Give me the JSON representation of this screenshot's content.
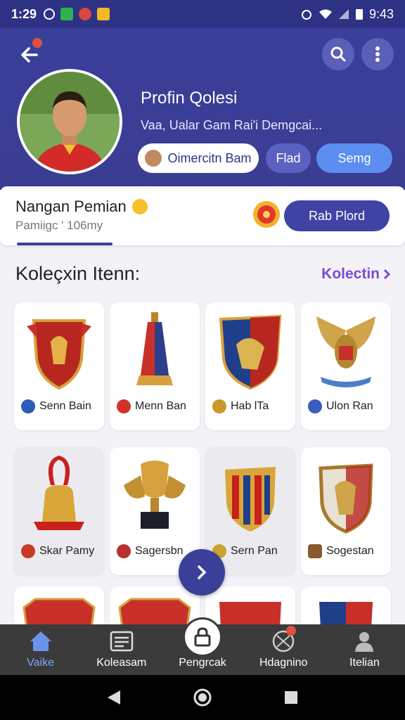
{
  "status_bar": {
    "time": "1:29",
    "right_time": "9:43"
  },
  "header": {
    "profile_name": "Profin Qolesi",
    "profile_subtitle": "Vaa, Ualar Gam Rai'i Demgcai...",
    "chip_primary": "Oimercitn Bam",
    "chip_secondary": "Flad",
    "chip_tertiary": "Semg"
  },
  "info_card": {
    "title": "Nangan Pemian",
    "subtitle": "Pamiigc ' 106my",
    "cta_label": "Rab Plord"
  },
  "section": {
    "title": "Koleçxin Itenn:",
    "link_label": "Kolectin"
  },
  "items": [
    {
      "label": "Senn Bain",
      "art": "shield-red-crest",
      "badge_color": "#2d5cb8"
    },
    {
      "label": "Menn Ban",
      "art": "gold-trophy-vase",
      "badge_color": "#d3322c"
    },
    {
      "label": "Hab lTa",
      "art": "shield-blue-red",
      "badge_color": "#c89a2a"
    },
    {
      "label": "Ulon Ran",
      "art": "eagle-emblem",
      "badge_color": "#3b5cc0"
    },
    {
      "label": "Skar Pamy",
      "art": "red-bell-medal",
      "badge_color": "#c73a2a"
    },
    {
      "label": "Sagersbn",
      "art": "winged-trophy",
      "badge_color": "#b83030"
    },
    {
      "label": "Sern Pan",
      "art": "striped-shield",
      "badge_color": "#c9a233"
    },
    {
      "label": "Sogestan",
      "art": "horse-shield",
      "badge_color": "#8a5a2a"
    }
  ],
  "bottom_nav": [
    {
      "label": "Vaike",
      "icon": "home-icon"
    },
    {
      "label": "Koleasam",
      "icon": "inbox-icon"
    },
    {
      "label": "Pengrcak",
      "icon": "lock-icon"
    },
    {
      "label": "Hdagnino",
      "icon": "ball-icon"
    },
    {
      "label": "Itelian",
      "icon": "person-icon"
    }
  ],
  "colors": {
    "primary": "#3b3f9a",
    "accent_link": "#7c4bd2",
    "cta": "#3f43a3",
    "pill_blue": "#5c8df0"
  }
}
